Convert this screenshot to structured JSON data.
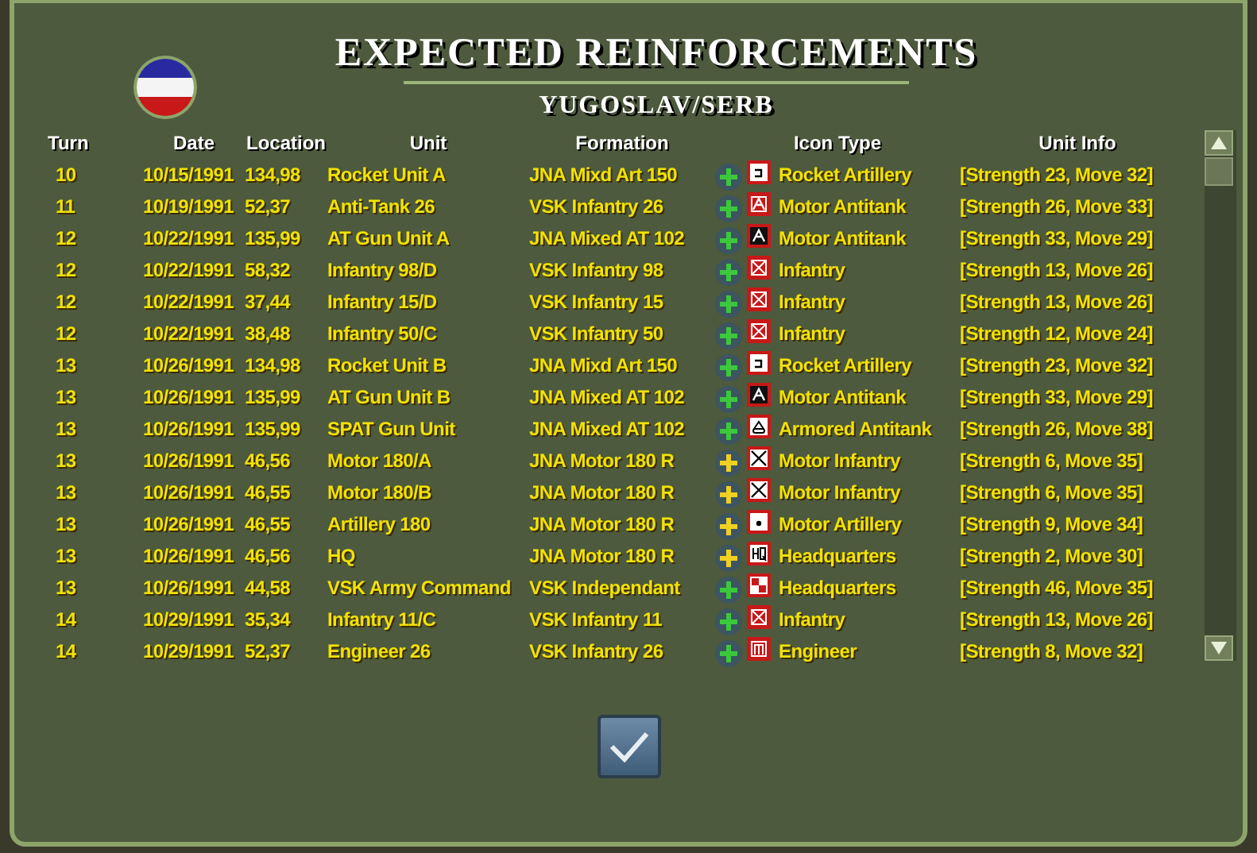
{
  "dialog": {
    "title": "EXPECTED REINFORCEMENTS",
    "subtitle": "YUGOSLAV/SERB"
  },
  "table": {
    "columns": [
      "Turn",
      "Date",
      "Location",
      "Unit",
      "Formation",
      "Icon Type",
      "Unit Info"
    ],
    "rows": [
      {
        "turn": "10",
        "date": "10/15/1991",
        "location": "134,98",
        "unit": "Rocket Unit A",
        "formation": "JNA Mixd Art 150",
        "color": "#3cc83c",
        "kind": "rocket",
        "icon_type": "Rocket Artillery",
        "info": "[Strength 23, Move 32]"
      },
      {
        "turn": "11",
        "date": "10/19/1991",
        "location": "52,37",
        "unit": "Anti-Tank 26",
        "formation": "VSK Infantry 26",
        "color": "#3cc83c",
        "kind": "antitank",
        "icon_type": "Motor Antitank",
        "info": "[Strength 26, Move 33]"
      },
      {
        "turn": "12",
        "date": "10/22/1991",
        "location": "135,99",
        "unit": "AT Gun Unit A",
        "formation": "JNA Mixed AT 102",
        "color": "#3cc83c",
        "kind": "antitank-dark",
        "icon_type": "Motor Antitank",
        "info": "[Strength 33, Move 29]"
      },
      {
        "turn": "12",
        "date": "10/22/1991",
        "location": "58,32",
        "unit": "Infantry 98/D",
        "formation": "VSK Infantry 98",
        "color": "#3cc83c",
        "kind": "infantry",
        "icon_type": "Infantry",
        "info": "[Strength 13, Move 26]"
      },
      {
        "turn": "12",
        "date": "10/22/1991",
        "location": "37,44",
        "unit": "Infantry 15/D",
        "formation": "VSK Infantry 15",
        "color": "#3cc83c",
        "kind": "infantry",
        "icon_type": "Infantry",
        "info": "[Strength 13, Move 26]"
      },
      {
        "turn": "12",
        "date": "10/22/1991",
        "location": "38,48",
        "unit": "Infantry 50/C",
        "formation": "VSK Infantry 50",
        "color": "#3cc83c",
        "kind": "infantry",
        "icon_type": "Infantry",
        "info": "[Strength 12, Move 24]"
      },
      {
        "turn": "13",
        "date": "10/26/1991",
        "location": "134,98",
        "unit": "Rocket Unit B",
        "formation": "JNA Mixd Art 150",
        "color": "#3cc83c",
        "kind": "rocket",
        "icon_type": "Rocket Artillery",
        "info": "[Strength 23, Move 32]"
      },
      {
        "turn": "13",
        "date": "10/26/1991",
        "location": "135,99",
        "unit": "AT Gun Unit B",
        "formation": "JNA Mixed AT 102",
        "color": "#3cc83c",
        "kind": "antitank-dark",
        "icon_type": "Motor Antitank",
        "info": "[Strength 33, Move 29]"
      },
      {
        "turn": "13",
        "date": "10/26/1991",
        "location": "135,99",
        "unit": "SPAT Gun Unit",
        "formation": "JNA Mixed AT 102",
        "color": "#3cc83c",
        "kind": "armored-antitank",
        "icon_type": "Armored Antitank",
        "info": "[Strength 26, Move 38]"
      },
      {
        "turn": "13",
        "date": "10/26/1991",
        "location": "46,56",
        "unit": "Motor 180/A",
        "formation": "JNA Motor 180 R",
        "color": "#f0d020",
        "kind": "motor-infantry",
        "icon_type": "Motor Infantry",
        "info": "[Strength 6, Move 35]"
      },
      {
        "turn": "13",
        "date": "10/26/1991",
        "location": "46,55",
        "unit": "Motor 180/B",
        "formation": "JNA Motor 180 R",
        "color": "#f0d020",
        "kind": "motor-infantry",
        "icon_type": "Motor Infantry",
        "info": "[Strength 6, Move 35]"
      },
      {
        "turn": "13",
        "date": "10/26/1991",
        "location": "46,55",
        "unit": "Artillery 180",
        "formation": "JNA Motor 180 R",
        "color": "#f0d020",
        "kind": "motor-artillery",
        "icon_type": "Motor Artillery",
        "info": "[Strength 9, Move 34]"
      },
      {
        "turn": "13",
        "date": "10/26/1991",
        "location": "46,56",
        "unit": "HQ",
        "formation": "JNA Motor 180 R",
        "color": "#f0d020",
        "kind": "hq-dark",
        "icon_type": "Headquarters",
        "info": "[Strength 2, Move 30]"
      },
      {
        "turn": "13",
        "date": "10/26/1991",
        "location": "44,58",
        "unit": "VSK Army Command",
        "formation": "VSK Independant",
        "color": "#3cc83c",
        "kind": "hq-checker",
        "icon_type": "Headquarters",
        "info": "[Strength 46, Move 35]"
      },
      {
        "turn": "14",
        "date": "10/29/1991",
        "location": "35,34",
        "unit": "Infantry 11/C",
        "formation": "VSK Infantry 11",
        "color": "#3cc83c",
        "kind": "infantry",
        "icon_type": "Infantry",
        "info": "[Strength 13, Move 26]"
      },
      {
        "turn": "14",
        "date": "10/29/1991",
        "location": "52,37",
        "unit": "Engineer 26",
        "formation": "VSK Infantry 26",
        "color": "#3cc83c",
        "kind": "engineer",
        "icon_type": "Engineer",
        "info": "[Strength 8, Move 32]"
      }
    ]
  }
}
